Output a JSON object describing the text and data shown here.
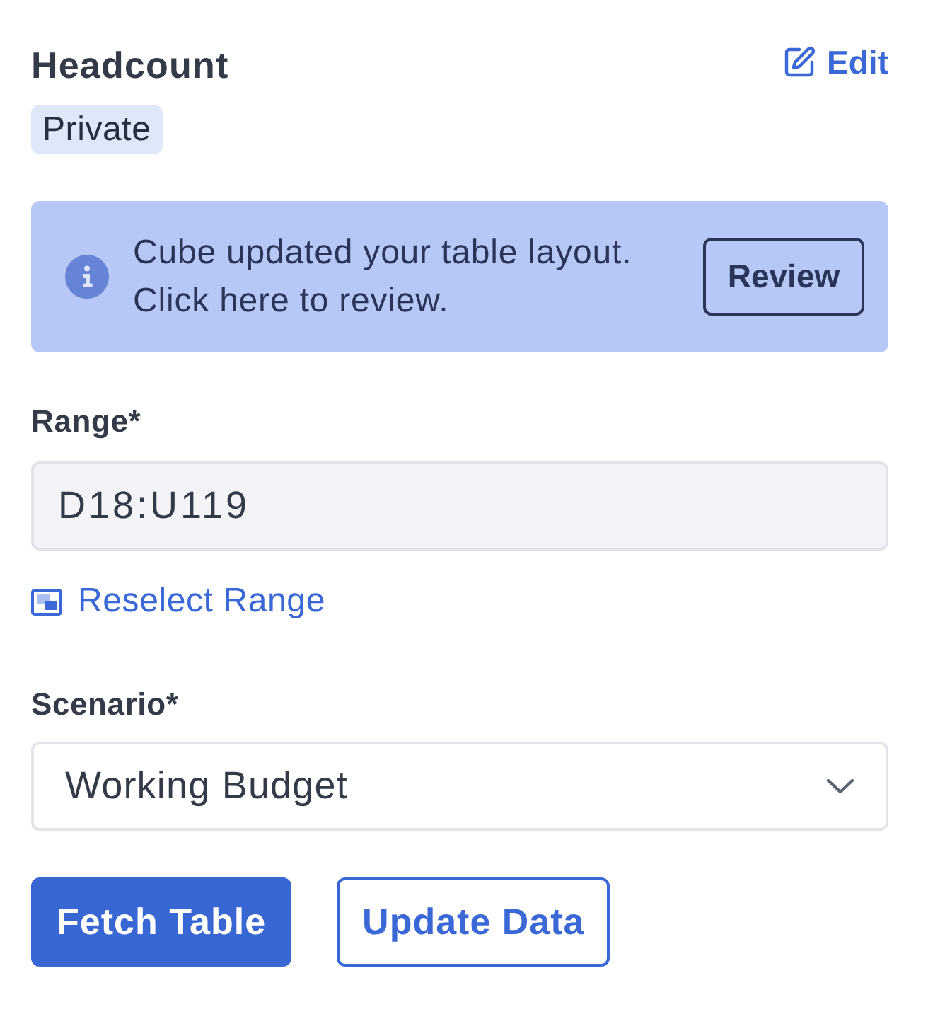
{
  "header": {
    "title": "Headcount",
    "edit_link": "Edit",
    "badge": "Private"
  },
  "notice": {
    "message": "Cube updated your table layout. Click here to review.",
    "button": "Review"
  },
  "range": {
    "label": "Range*",
    "value": "D18:U119",
    "link": "Reselect Range"
  },
  "scenario": {
    "label": "Scenario*",
    "value": "Working Budget"
  },
  "buttons": [
    {
      "label": "Fetch Table",
      "kind": "primary"
    },
    {
      "label": "Update Data",
      "kind": "secondary"
    }
  ]
}
